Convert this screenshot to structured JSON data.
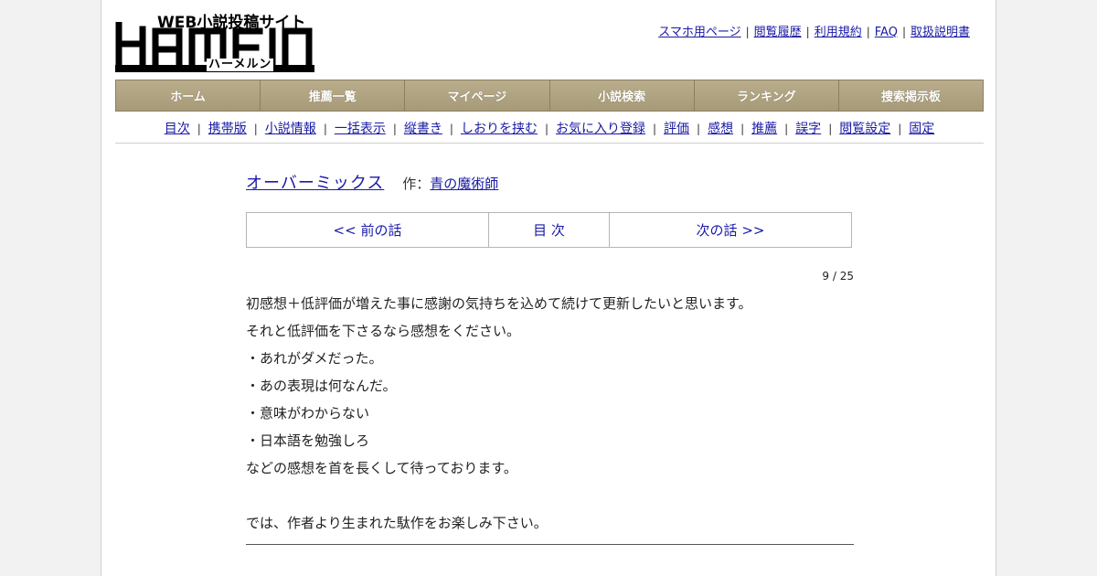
{
  "logo": {
    "tagline": "WEB小説投稿サイト",
    "wordmark": "HAMELN",
    "kana": "ハーメルン"
  },
  "header_links": [
    "スマホ用ページ",
    "閲覧履歴",
    "利用規約",
    "FAQ",
    "取扱説明書"
  ],
  "main_nav": [
    "ホーム",
    "推薦一覧",
    "マイページ",
    "小説検索",
    "ランキング",
    "捜索掲示板"
  ],
  "sub_nav": [
    "目次",
    "携帯版",
    "小説情報",
    "一括表示",
    "縦書き",
    "しおりを挟む",
    "お気に入り登録",
    "評価",
    "感想",
    "推薦",
    "誤字",
    "閲覧設定",
    "固定"
  ],
  "novel": {
    "title": "オーバーミックス",
    "author_prefix": "作：",
    "author": "青の魔術師"
  },
  "chapter_nav": {
    "prev": "<< 前の話",
    "toc": "目 次",
    "next": "次の話 >>"
  },
  "page_counter": "9 / 25",
  "preface_lines": [
    "初感想＋低評価が増えた事に感謝の気持ちを込めて続けて更新したいと思います。",
    "それと低評価を下さるなら感想をください。",
    "・あれがダメだった。",
    "・あの表現は何なんだ。",
    "・意味がわからない",
    "・日本語を勉強しろ",
    "などの感想を首を長くして待っております。",
    "",
    "では、作者より生まれた駄作をお楽しみ下さい。"
  ]
}
